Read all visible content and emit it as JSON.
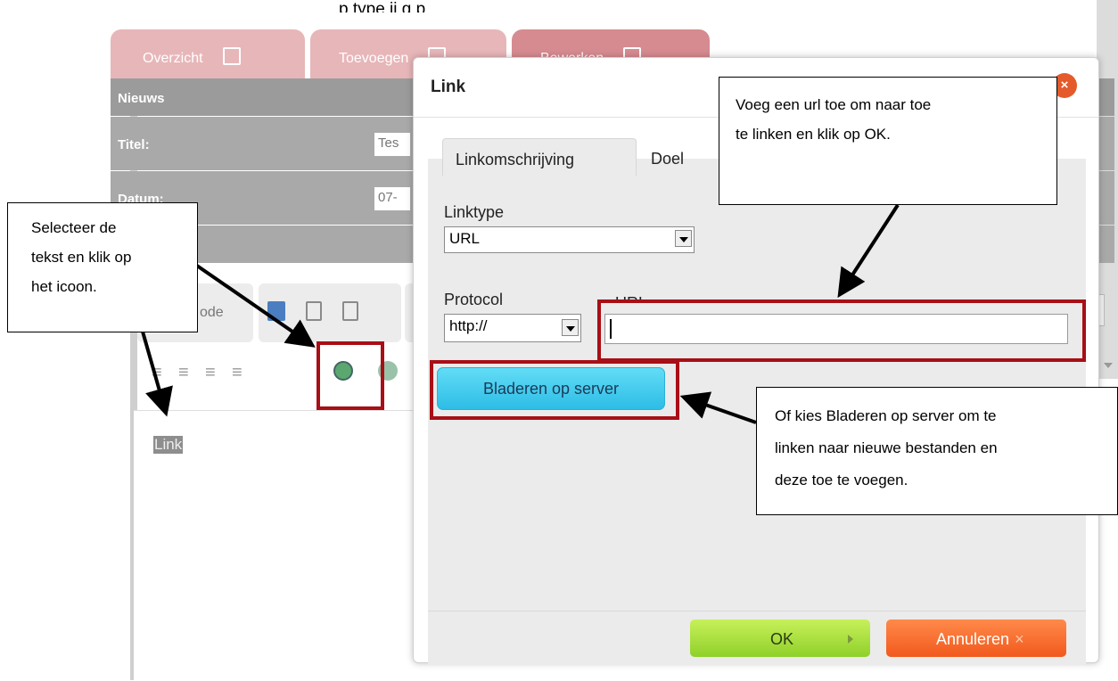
{
  "top_text_cut": "p       type        ij g        p",
  "tabs": [
    {
      "label": "Overzicht"
    },
    {
      "label": "Toevoegen"
    },
    {
      "label": "Bewerken"
    }
  ],
  "section_title": "Nieuws",
  "form_rows": [
    {
      "label": "Titel:",
      "value": "Tes"
    },
    {
      "label": "Datum:",
      "value": "07-"
    }
  ],
  "toolbar": {
    "source_label": "ode"
  },
  "editor": {
    "selected_text": "Link"
  },
  "dialog": {
    "title": "Link",
    "close_label": "×",
    "tabs": [
      {
        "label": "Linkomschrijving"
      },
      {
        "label": "Doel"
      }
    ],
    "linktype_label": "Linktype",
    "linktype_value": "URL",
    "protocol_label": "Protocol",
    "protocol_value": "http://",
    "url_label": "URL",
    "url_value": "",
    "browse_label": "Bladeren op server",
    "ok_label": "OK",
    "cancel_label": "Annuleren",
    "cancel_x": "×"
  },
  "callouts": {
    "left": [
      "Selecteer de",
      "tekst en klik op",
      "het icoon."
    ],
    "top_right": [
      "Voeg een url toe om naar toe",
      "te linken en klik op OK."
    ],
    "bottom_right": [
      "Of kies Bladeren op server om  te",
      "linken naar nieuwe bestanden en",
      "deze toe te voegen."
    ]
  },
  "colors": {
    "tab_pink": "#e7b6b9",
    "tab_active": "#d68b90",
    "highlight_red": "#a80f16",
    "ok_green": "#a6dd3a",
    "cancel_orange": "#f2591d",
    "browse_cyan": "#3cc8ea"
  }
}
